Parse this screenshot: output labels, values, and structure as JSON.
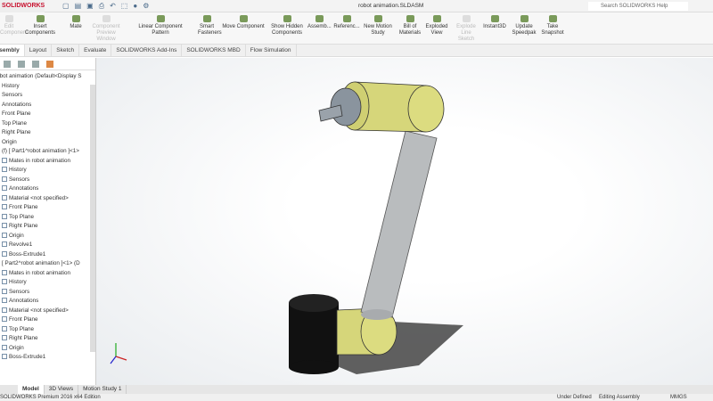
{
  "app": {
    "logo": "SOLIDWORKS",
    "document_title": "robot animation.SLDASM",
    "search_placeholder": "Search SOLIDWORKS Help"
  },
  "toolbar": [
    {
      "label": "Edit Component",
      "disabled": true
    },
    {
      "label": "Insert Components"
    },
    {
      "label": "Mate"
    },
    {
      "label": "Component Preview Window",
      "disabled": true
    },
    {
      "label": "Linear Component Pattern"
    },
    {
      "label": "Smart Fasteners"
    },
    {
      "label": "Move Component"
    },
    {
      "label": "Show Hidden Components"
    },
    {
      "label": "Assemb..."
    },
    {
      "label": "Referenc..."
    },
    {
      "label": "New Motion Study"
    },
    {
      "label": "Bill of Materials"
    },
    {
      "label": "Exploded View"
    },
    {
      "label": "Explode Line Sketch",
      "disabled": true
    },
    {
      "label": "Instant3D"
    },
    {
      "label": "Update Speedpak"
    },
    {
      "label": "Take Snapshot"
    }
  ],
  "tabs": [
    "Assembly",
    "Layout",
    "Sketch",
    "Evaluate",
    "SOLIDWORKS Add-Ins",
    "SOLIDWORKS MBD",
    "Flow Simulation"
  ],
  "tree": [
    "robot animation  (Default<Display S",
    "History",
    "Sensors",
    "Annotations",
    "Front Plane",
    "Top Plane",
    "Right Plane",
    "Origin",
    "(f) [ Part1^robot animation ]<1>",
    "Mates in robot animation",
    "History",
    "Sensors",
    "Annotations",
    "Material <not specified>",
    "Front Plane",
    "Top Plane",
    "Right Plane",
    "Origin",
    "Revolve1",
    "Boss-Extrude1",
    "[ Part2^robot animation ]<1> (D",
    "Mates in robot animation",
    "History",
    "Sensors",
    "Annotations",
    "Material <not specified>",
    "Front Plane",
    "Top Plane",
    "Right Plane",
    "Origin",
    "Boss-Extrude1"
  ],
  "bottom_tabs": [
    "Model",
    "3D Views",
    "Motion Study 1"
  ],
  "status": {
    "edition": "SOLIDWORKS Premium 2016 x64 Edition",
    "state": "Under Defined",
    "mode": "Editing Assembly",
    "units": "MMGS"
  },
  "colors": {
    "joint": "#d8d77a",
    "link": "#b9bcbe",
    "base": "#111111"
  }
}
